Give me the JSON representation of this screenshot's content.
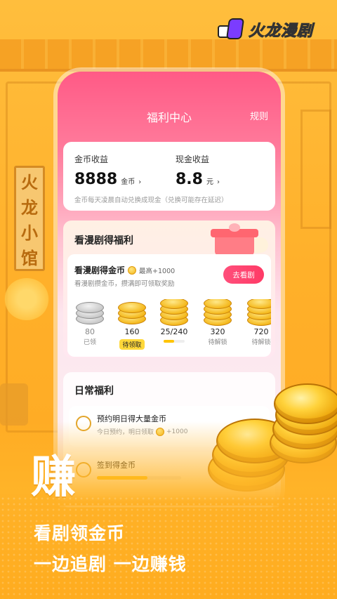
{
  "brand": {
    "name": "火龙漫剧",
    "colors": {
      "primary": "#ff3a66",
      "gold": "#f4b81c",
      "bg": "#ffb126"
    }
  },
  "store_sign": [
    "火",
    "龙",
    "小",
    "馆"
  ],
  "phone": {
    "title": "福利中心",
    "rules": "规则",
    "earnings": {
      "coin_label": "金币收益",
      "coin_value": "8888",
      "coin_unit": "金币",
      "cash_label": "现金收益",
      "cash_value": "8.8",
      "cash_unit": "元",
      "note": "金币每天凌晨自动兑换成现金（兑换可能存在延迟）",
      "chevron": "›"
    },
    "watch": {
      "heading": "看漫剧得福利",
      "title": "看漫剧得金币",
      "max": "最高+1000",
      "subtitle": "看漫剧攒金币，攒满即可领取奖励",
      "button": "去看剧",
      "coins": [
        {
          "amount": "80",
          "status": "已领",
          "type": "silver"
        },
        {
          "amount": "160",
          "status": "待领取",
          "type": "gold"
        },
        {
          "amount": "25/240",
          "status": "",
          "type": "gold",
          "progress": 0.5
        },
        {
          "amount": "320",
          "status": "待解锁",
          "type": "gold"
        },
        {
          "amount": "720",
          "status": "待解锁",
          "type": "gold"
        }
      ]
    },
    "daily": {
      "heading": "日常福利",
      "items": [
        {
          "title": "预约明日得大量金币",
          "subtitle": "今日预约，明日领取",
          "reward": "+1000",
          "icon": "clock-icon"
        },
        {
          "title": "签到得金币",
          "progress": 0.6,
          "icon": "calendar-icon"
        }
      ]
    }
  },
  "promo": {
    "big_word": "赚",
    "line1": "看剧领金币",
    "line2": "一边追剧 一边赚钱"
  }
}
